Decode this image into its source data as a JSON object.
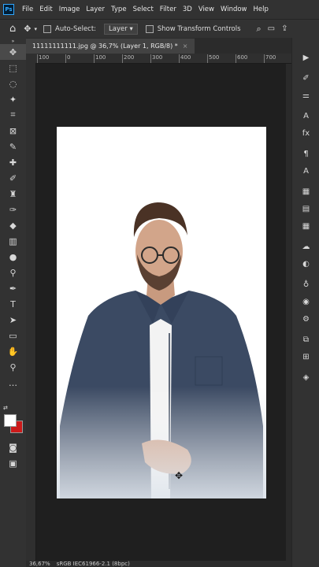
{
  "menubar": {
    "logo": "Ps",
    "items": [
      "File",
      "Edit",
      "Image",
      "Layer",
      "Type",
      "Select",
      "Filter",
      "3D",
      "View",
      "Window",
      "Help"
    ]
  },
  "options": {
    "auto_select_label": "Auto-Select:",
    "layer_select": "Layer",
    "show_transform_label": "Show Transform Controls"
  },
  "document": {
    "tab_title": "11111111111.jpg @ 36,7% (Layer 1, RGB/8) *",
    "close": "×"
  },
  "ruler": {
    "h_labels": [
      "100",
      "0",
      "100",
      "200",
      "300",
      "400",
      "500",
      "600",
      "700",
      "800"
    ]
  },
  "status": {
    "zoom": "36,67%",
    "profile": "sRGB IEC61966-2.1 (8bpc)"
  },
  "colors": {
    "foreground": "#ffffff",
    "background": "#cc1a1a",
    "accent": "#31a8ff"
  }
}
